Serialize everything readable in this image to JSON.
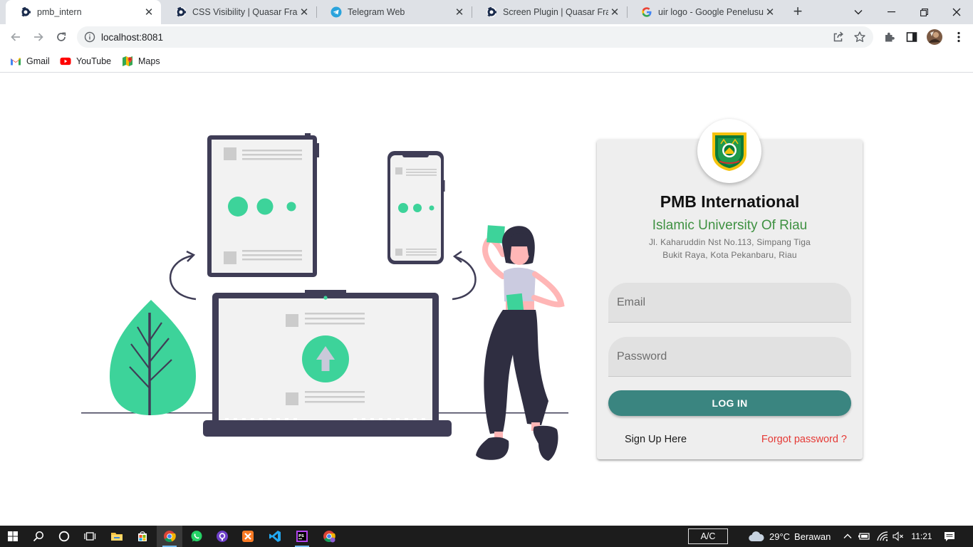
{
  "browser": {
    "tabs": [
      {
        "title": "pmb_intern",
        "icon": "quasar-icon",
        "active": true
      },
      {
        "title": "CSS Visibility | Quasar Framew",
        "icon": "quasar-icon",
        "active": false
      },
      {
        "title": "Telegram Web",
        "icon": "telegram-icon",
        "active": false
      },
      {
        "title": "Screen Plugin | Quasar Framew",
        "icon": "quasar-icon",
        "active": false
      },
      {
        "title": "uir logo - Google Penelusuran",
        "icon": "google-icon",
        "active": false
      }
    ],
    "new_tab": "+",
    "address": "localhost:8081",
    "bookmarks": [
      {
        "label": "Gmail",
        "icon": "gmail-icon"
      },
      {
        "label": "YouTube",
        "icon": "youtube-icon"
      },
      {
        "label": "Maps",
        "icon": "maps-icon"
      }
    ]
  },
  "colors": {
    "accent_green": "#3dd39a",
    "dark_navy": "#3f3d56",
    "login_button": "#3a8580",
    "university_green": "#3f9142",
    "forgot_red": "#e53935",
    "skin": "#ffb6b6"
  },
  "login": {
    "title": "PMB International",
    "university": "Islamic University Of Riau",
    "address_line1": "Jl. Kaharuddin Nst No.113, Simpang Tiga",
    "address_line2": "Bukit Raya, Kota Pekanbaru, Riau",
    "email_label": "Email",
    "password_label": "Password",
    "login_button": "LOG IN",
    "signup_link": "Sign Up Here",
    "forgot_link": "Forgot password ?"
  },
  "taskbar": {
    "ac_label": "A/C",
    "temperature": "29°C",
    "weather": "Berawan",
    "time": "11:21"
  }
}
